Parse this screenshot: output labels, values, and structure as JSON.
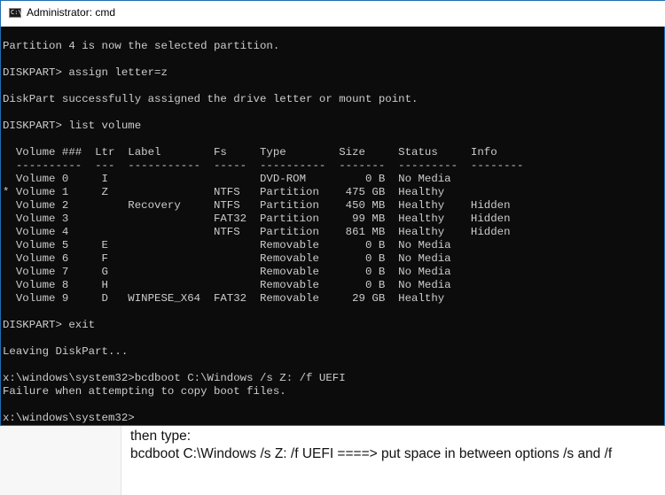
{
  "window": {
    "title": "Administrator: cmd",
    "icon": "cmd-icon",
    "icon_text": "C:\\"
  },
  "console": {
    "lines": [
      "",
      "Partition 4 is now the selected partition.",
      "",
      "DISKPART> assign letter=z",
      "",
      "DiskPart successfully assigned the drive letter or mount point.",
      "",
      "DISKPART> list volume",
      "",
      "  Volume ###  Ltr  Label        Fs     Type        Size     Status     Info",
      "  ----------  ---  -----------  -----  ----------  -------  ---------  --------",
      "  Volume 0     I                       DVD-ROM         0 B  No Media",
      "* Volume 1     Z                NTFS   Partition    475 GB  Healthy",
      "  Volume 2         Recovery     NTFS   Partition    450 MB  Healthy    Hidden",
      "  Volume 3                      FAT32  Partition     99 MB  Healthy    Hidden",
      "  Volume 4                      NTFS   Partition    861 MB  Healthy    Hidden",
      "  Volume 5     E                       Removable       0 B  No Media",
      "  Volume 6     F                       Removable       0 B  No Media",
      "  Volume 7     G                       Removable       0 B  No Media",
      "  Volume 8     H                       Removable       0 B  No Media",
      "  Volume 9     D   WINPESE_X64  FAT32  Removable     29 GB  Healthy",
      "",
      "DISKPART> exit",
      "",
      "Leaving DiskPart...",
      "",
      "x:\\windows\\system32>bcdboot C:\\Windows /s Z: /f UEFI",
      "Failure when attempting to copy boot files.",
      "",
      "x:\\windows\\system32>"
    ]
  },
  "annotation": {
    "line1": "then type:",
    "line2": "bcdboot C:\\Windows /s Z: /f UEFI ====> put space in between options /s and /f"
  },
  "colors": {
    "console_bg": "#0c0c0c",
    "console_text": "#cccccc",
    "window_border": "#1f6fb2"
  }
}
